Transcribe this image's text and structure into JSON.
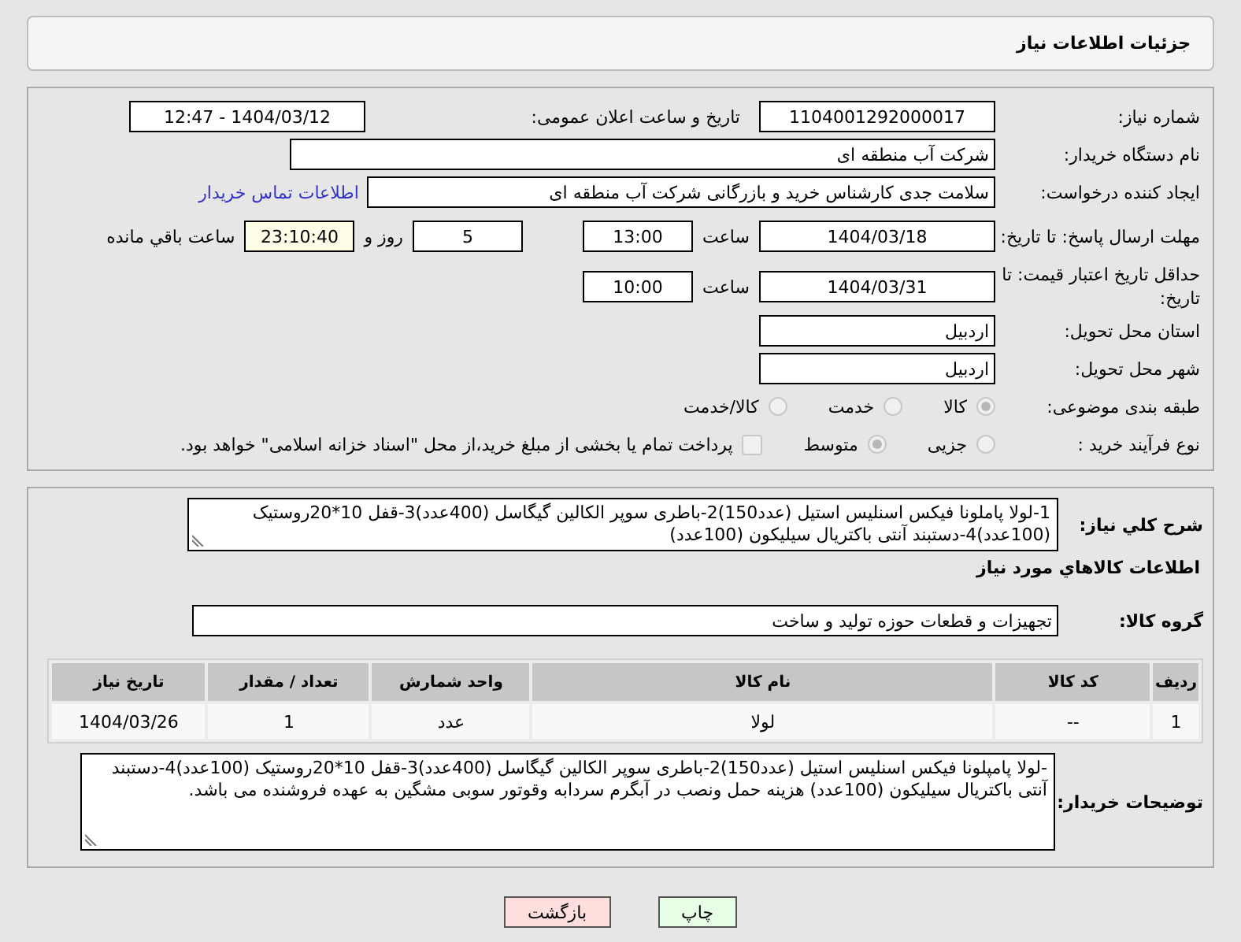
{
  "header": {
    "title": "جزئیات اطلاعات نیاز"
  },
  "need_number": {
    "label": "شماره نیاز:",
    "value": "1104001292000017"
  },
  "announce": {
    "label": "تاریخ و ساعت اعلان عمومی:",
    "value": "1404/03/12 - 12:47"
  },
  "buyer_org": {
    "label": "نام دستگاه خریدار:",
    "value": "شرکت آب منطقه ای"
  },
  "requester": {
    "label": "ایجاد کننده درخواست:",
    "value": "سلامت جدی کارشناس خرید و بازرگانی شرکت آب منطقه ای",
    "link": "اطلاعات تماس خریدار"
  },
  "deadline": {
    "label": "مهلت ارسال پاسخ: تا تاریخ:",
    "date": "1404/03/18",
    "time_label": "ساعت",
    "time": "13:00",
    "days": "5",
    "days_label": "روز و",
    "remaining": "23:10:40",
    "remaining_label": "ساعت باقي مانده"
  },
  "validity": {
    "label": "حداقل تاریخ اعتبار قیمت: تا تاریخ:",
    "date": "1404/03/31",
    "time_label": "ساعت",
    "time": "10:00"
  },
  "province": {
    "label": "استان محل تحویل:",
    "value": "اردبیل"
  },
  "city": {
    "label": "شهر محل تحویل:",
    "value": "اردبیل"
  },
  "category": {
    "label": "طبقه بندی موضوعی:",
    "options": [
      {
        "label": "کالا",
        "selected": true
      },
      {
        "label": "خدمت",
        "selected": false
      },
      {
        "label": "کالا/خدمت",
        "selected": false
      }
    ]
  },
  "process": {
    "label": "نوع فرآیند خرید :",
    "options": [
      {
        "label": "جزیی",
        "selected": false
      },
      {
        "label": "متوسط",
        "selected": true
      }
    ],
    "payment": {
      "label": "پرداخت تمام یا بخشی از مبلغ خرید،از محل \"اسناد خزانه اسلامی\" خواهد بود.",
      "checked": false
    }
  },
  "description": {
    "label": "شرح کلي نياز:",
    "value": "1-لولا پاملونا فیکس اسنلیس استیل (عدد150)2-باطری سوپر الکالین گیگاسل (400عدد)3-قفل 10*20روستیک (100عدد)4-دستبند آنتی باکتریال سیلیکون (100عدد)"
  },
  "items_title": "اطلاعات کالاهاي مورد نياز",
  "group": {
    "label": "گروه کالا:",
    "value": "تجهیزات و قطعات حوزه تولید و ساخت"
  },
  "table": {
    "columns": [
      "رديف",
      "کد کالا",
      "نام کالا",
      "واحد شمارش",
      "تعداد / مقدار",
      "تاریخ نیاز"
    ],
    "rows": [
      [
        "1",
        "--",
        "لولا",
        "عدد",
        "1",
        "1404/03/26"
      ]
    ]
  },
  "buyer_notes": {
    "label": "توضیحات خریدار:",
    "value": "-لولا پامپلونا فیکس اسنلیس استیل (عدد150)2-باطری سوپر الکالین گیگاسل (400عدد)3-قفل 10*20روستیک (100عدد)4-دستبند آنتی باکتریال سیلیکون (100عدد) هزینه حمل ونصب در آبگرم سردابه وقوتور سوبی مشگین به عهده فروشنده می باشد."
  },
  "buttons": [
    {
      "label": "چاپ",
      "kind": "print"
    },
    {
      "label": "بازگشت",
      "kind": "back"
    }
  ]
}
